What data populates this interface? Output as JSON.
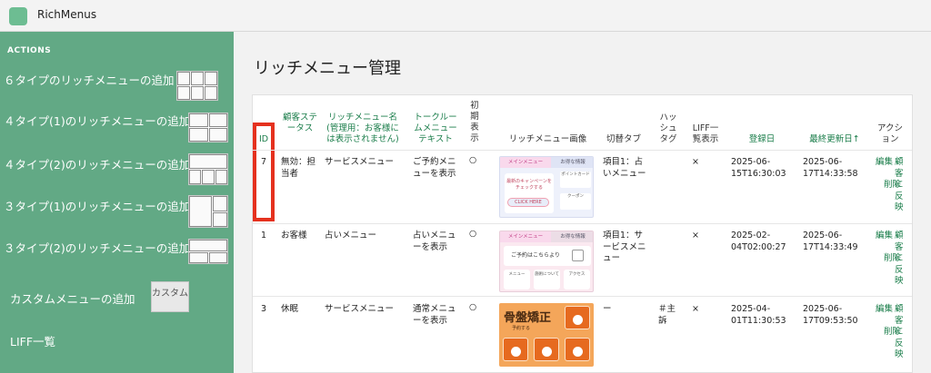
{
  "app": {
    "title": "RichMenus"
  },
  "sidebar": {
    "heading": "ACTIONS",
    "links": [
      {
        "label": "６タイプのリッチメニューの追加"
      },
      {
        "label": "４タイプ(1)のリッチメニューの追加"
      },
      {
        "label": "４タイプ(2)のリッチメニューの追加"
      },
      {
        "label": "３タイプ(1)のリッチメニューの追加"
      },
      {
        "label": "３タイプ(2)のリッチメニューの追加"
      },
      {
        "label": "カスタムメニューの追加",
        "thumb_label": "カスタム"
      },
      {
        "label": "LIFF一覧"
      }
    ]
  },
  "page": {
    "title": "リッチメニュー管理"
  },
  "table": {
    "headers": {
      "id": "ID",
      "status": "顧客ステータス",
      "name": "リッチメニュー名(管理用：お客様には表示されません)",
      "talk_text": "トークルームメニューテキスト",
      "initial": "初期表示",
      "image": "リッチメニュー画像",
      "switch_tab": "切替タブ",
      "hashtag": "ハッシュタグ",
      "liff": "LIFF一覧表示",
      "created": "登録日",
      "updated": "最終更新日↑",
      "action": "アクション"
    },
    "rows": [
      {
        "id": "7",
        "status": "無効：担当者",
        "name": "サービスメニュー",
        "talk_text": "ご予約メニューを表示",
        "initial": "○",
        "switch_tab": "項目1：占いメニュー",
        "hashtag": "",
        "liff": "×",
        "created": "2025-06-15T16:30:03",
        "updated": "2025-06-17T14:33:58",
        "actions": [
          "編集",
          "顧客に反映",
          "削除"
        ]
      },
      {
        "id": "1",
        "status": "お客様",
        "name": "占いメニュー",
        "talk_text": "占いメニューを表示",
        "initial": "○",
        "switch_tab": "項目1：サービスメニュー",
        "hashtag": "",
        "liff": "×",
        "created": "2025-02-04T02:00:27",
        "updated": "2025-06-17T14:33:49",
        "actions": [
          "編集",
          "顧客に反映",
          "削除"
        ]
      },
      {
        "id": "3",
        "status": "休眠",
        "name": "サービスメニュー",
        "talk_text": "通常メニューを表示",
        "initial": "○",
        "switch_tab": "ー",
        "hashtag": "＃主訴",
        "liff": "×",
        "created": "2025-04-01T11:30:53",
        "updated": "2025-06-17T09:53:50",
        "actions": [
          "編集",
          "顧客に反映",
          "削除"
        ]
      }
    ]
  },
  "menu_images": {
    "img1": {
      "tab_main": "メインメニュー",
      "tab_deal": "お得な情報",
      "campaign": "最新のキャンペーンをチェックする",
      "click": "CLICK HERE",
      "point_card": "ポイントカード",
      "coupon": "クーポン"
    },
    "img2": {
      "tab_main": "メインメニュー",
      "tab_deal": "お得な情報",
      "reserve": "ご予約はこちらより",
      "menu": "メニュー",
      "about": "施術について",
      "access": "アクセス"
    },
    "img3": {
      "title": "骨盤矯正",
      "sub": "予約する"
    }
  },
  "colors": {
    "sidebar": "#62a985",
    "link": "#1a7d4a",
    "highlight": "#e5311e"
  }
}
